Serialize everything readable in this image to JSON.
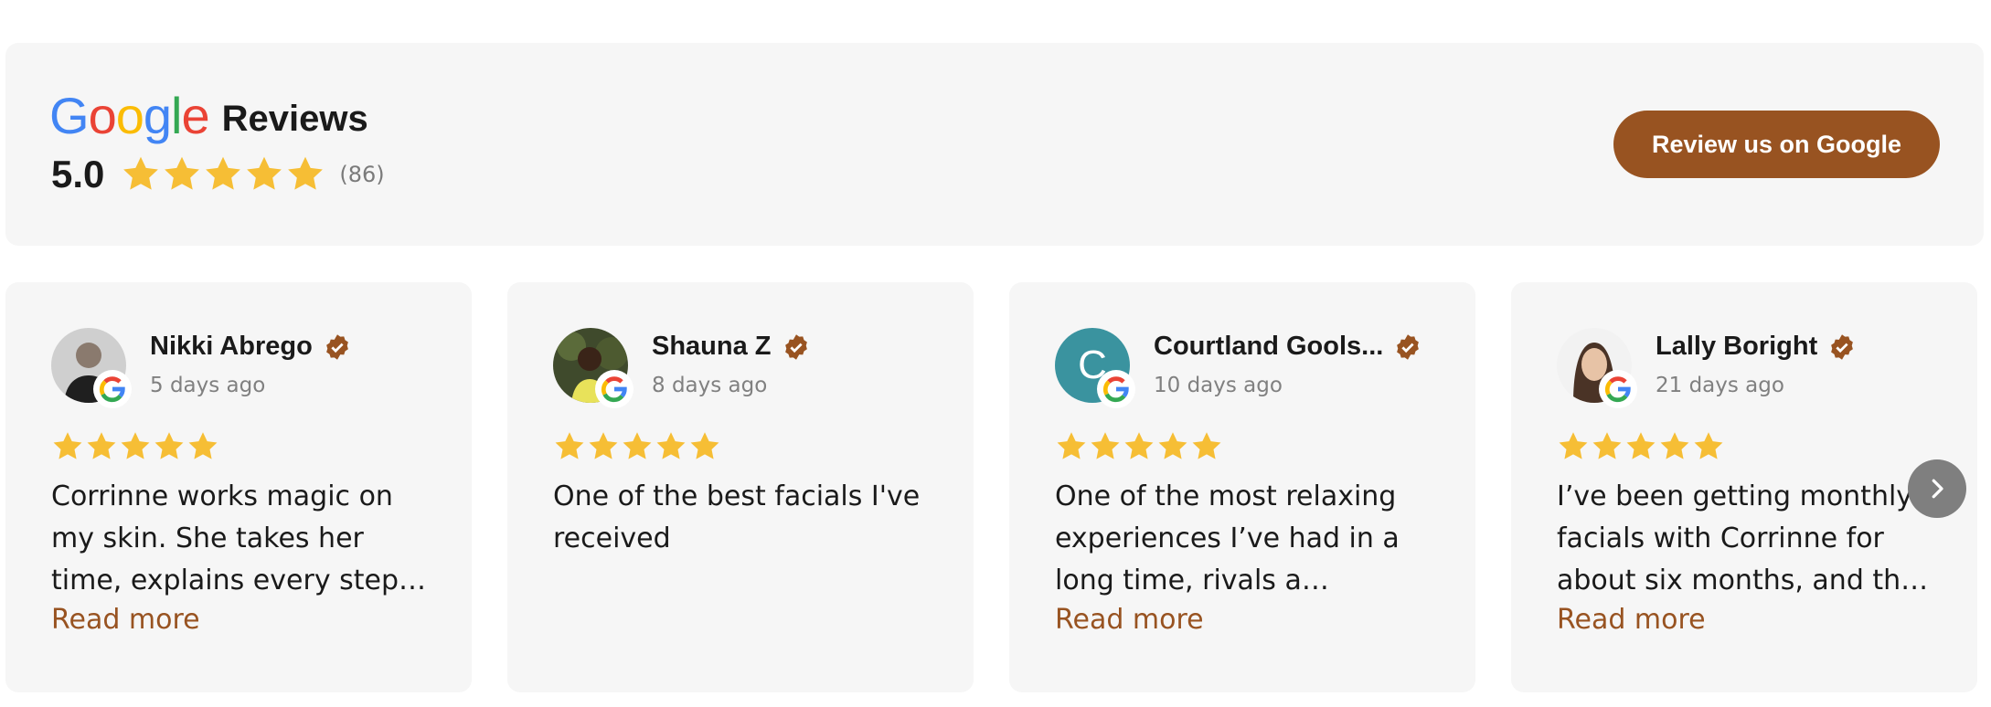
{
  "header": {
    "brand_letters": [
      {
        "char": "G",
        "color": "#4285F4"
      },
      {
        "char": "o",
        "color": "#EA4335"
      },
      {
        "char": "o",
        "color": "#FBBC05"
      },
      {
        "char": "g",
        "color": "#4285F4"
      },
      {
        "char": "l",
        "color": "#34A853"
      },
      {
        "char": "e",
        "color": "#EA4335"
      }
    ],
    "title": "Reviews",
    "rating": "5.0",
    "stars": 5,
    "count": "(86)",
    "cta_label": "Review us on Google"
  },
  "reviews": [
    {
      "name": "Nikki Abrego",
      "date": "5 days ago",
      "stars": 5,
      "text": "Corrinne works magic on my skin. She takes her time, explains every step and leaves my skin glowing.",
      "more": "Read more",
      "avatar": "photo"
    },
    {
      "name": "Shauna Z",
      "date": "8 days ago",
      "stars": 5,
      "text": "One of the best facials I've received",
      "more": "",
      "avatar": "photo"
    },
    {
      "name": "Courtland Gools...",
      "date": "10 days ago",
      "stars": 5,
      "text": "One of the most relaxing experiences I’ve had in a long time, rivals a massage.",
      "more": "Read more",
      "avatar": "C"
    },
    {
      "name": "Lally Boright",
      "date": "21 days ago",
      "stars": 5,
      "text": "I’ve been getting monthly facials with Corrinne for about six months, and the results have been amazing.",
      "more": "Read more",
      "avatar": "photo"
    }
  ],
  "colors": {
    "accent": "#985321",
    "star": "#F6BE35",
    "panel": "#F6F6F6",
    "avatar_initial_bg": "#3A939F"
  },
  "icons": {
    "verified": "verified-badge-icon",
    "google": "google-g-icon",
    "next": "chevron-right-icon"
  }
}
